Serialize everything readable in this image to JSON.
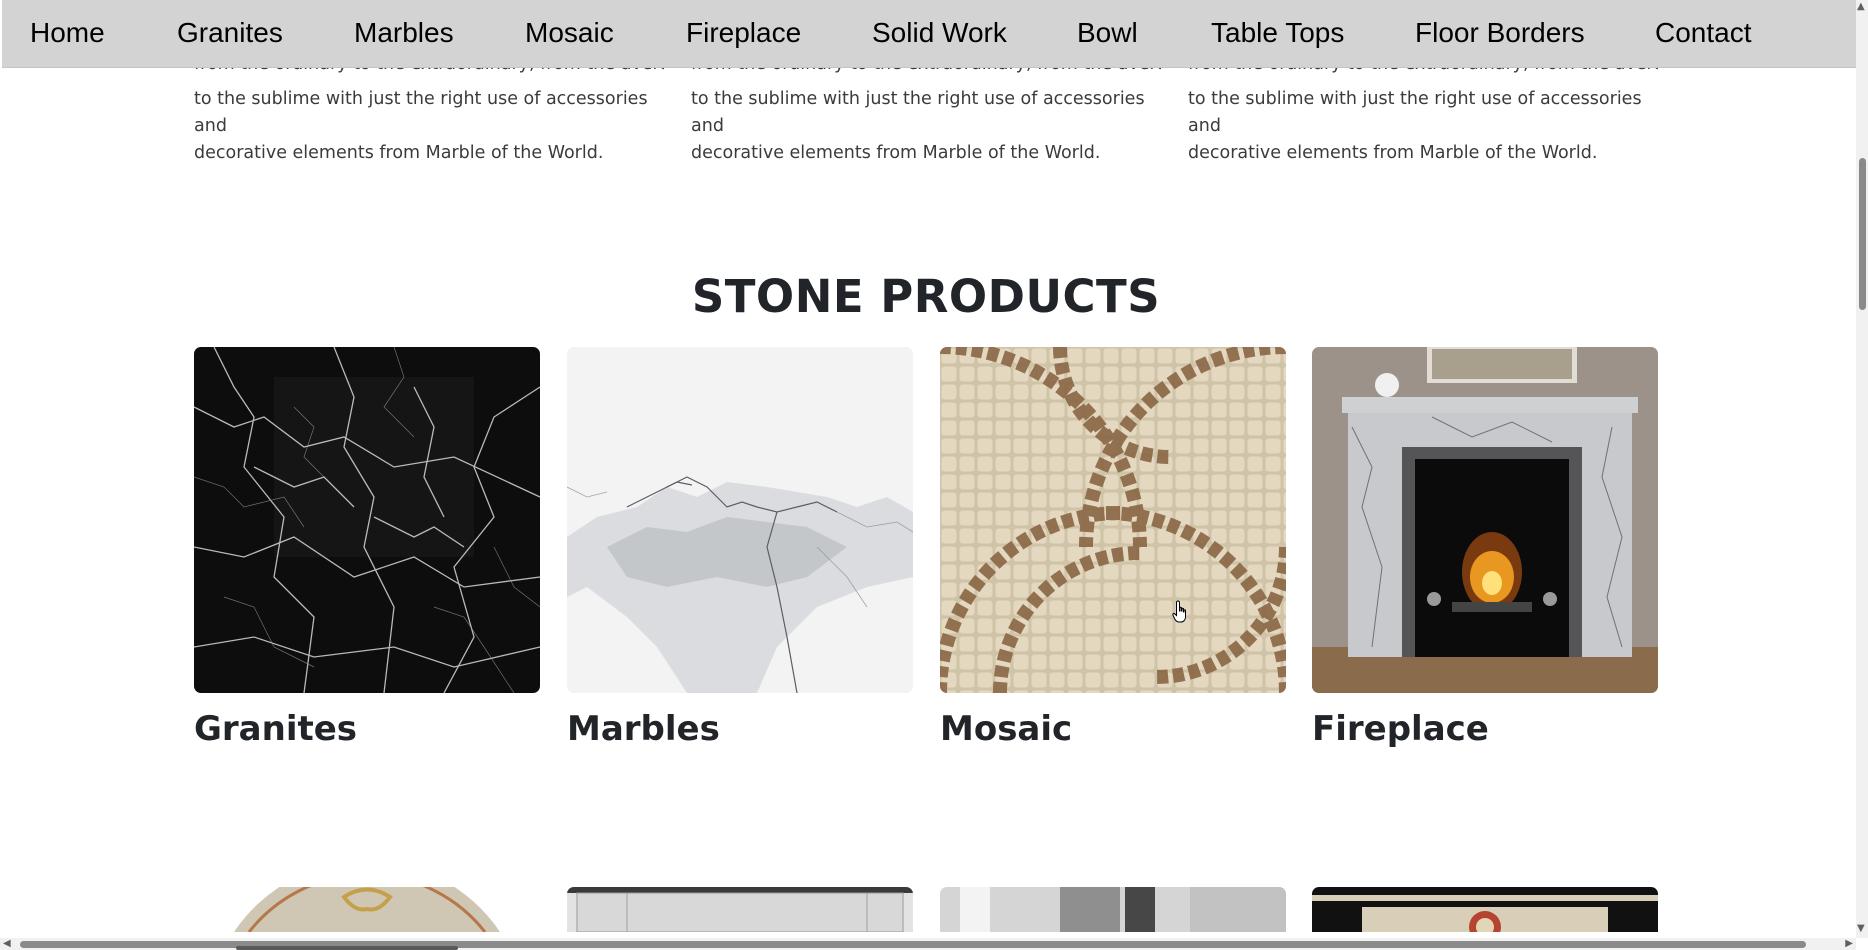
{
  "nav": {
    "items": [
      "Home",
      "Granites",
      "Marbles",
      "Mosaic",
      "Fireplace",
      "Solid Work",
      "Bowl",
      "Table Tops",
      "Floor Borders",
      "Contact"
    ]
  },
  "intro": {
    "cut_line": "from the ordinary to the extraordinary, from the average",
    "line2": "to the sublime with just the right use of accessories and",
    "line3": "decorative elements from Marble of the World."
  },
  "section": {
    "title": "STONE PRODUCTS"
  },
  "products": [
    {
      "label": "Granites",
      "image": "black-granite-image"
    },
    {
      "label": "Marbles",
      "image": "white-marble-image"
    },
    {
      "label": "Mosaic",
      "image": "mosaic-tile-image"
    },
    {
      "label": "Fireplace",
      "image": "fireplace-image"
    }
  ],
  "colors": {
    "nav_bg": "#d3d3d3",
    "heading": "#212529",
    "body_text": "#3b3b3b"
  }
}
